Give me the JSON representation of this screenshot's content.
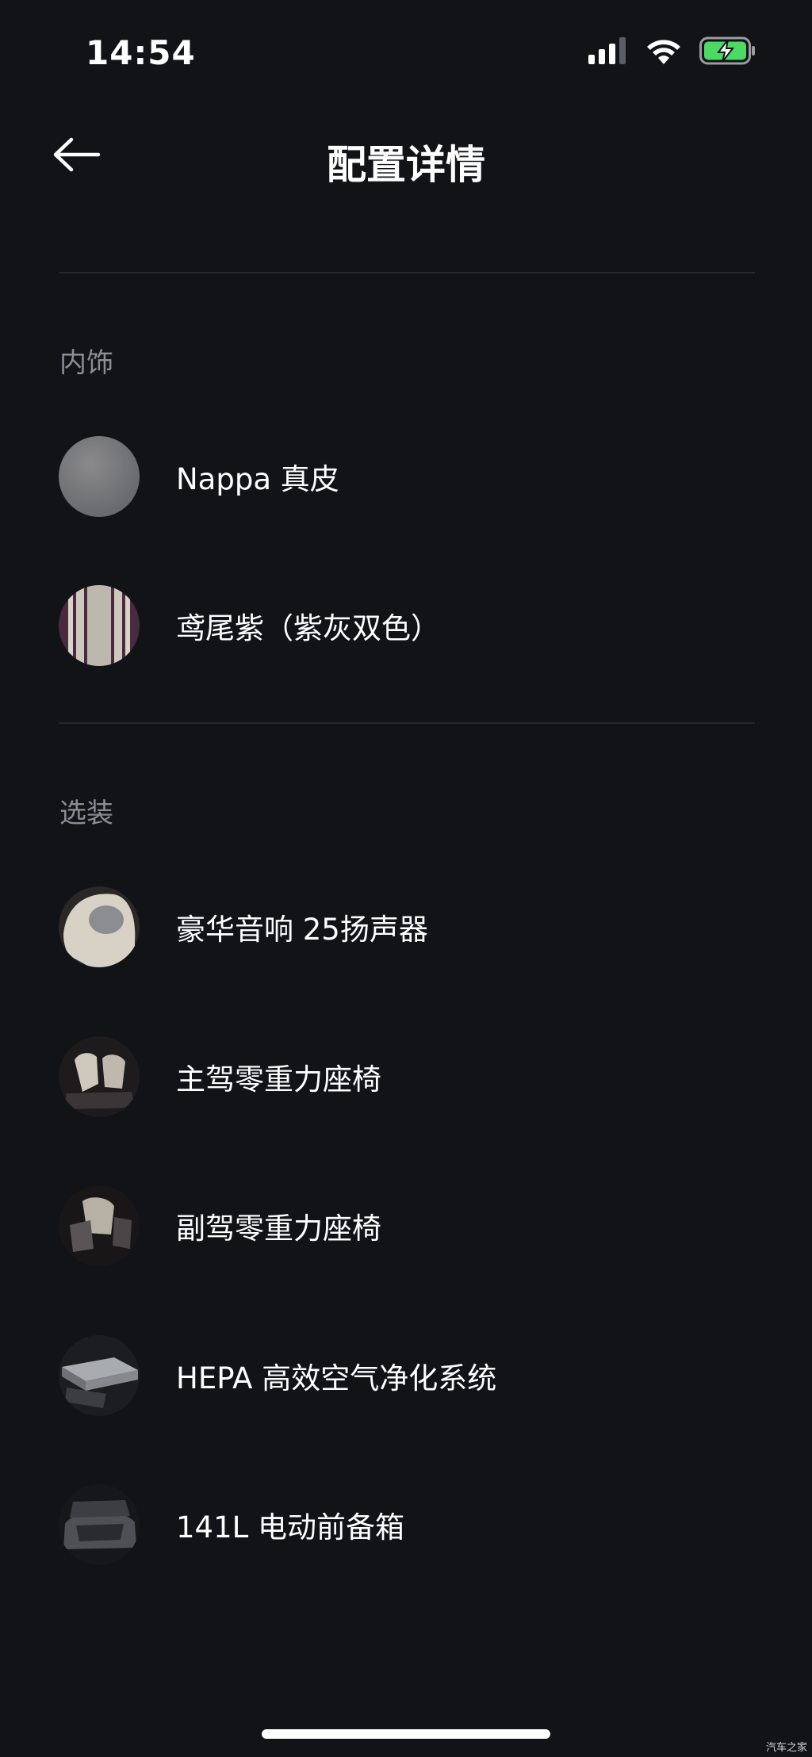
{
  "status_bar": {
    "time": "14:54",
    "icons": [
      "signal-icon",
      "wifi-icon",
      "battery-charging-icon"
    ],
    "battery_color": "#4cd964"
  },
  "header": {
    "back_icon": "arrow-left-icon",
    "title": "配置详情"
  },
  "sections": {
    "interior": {
      "title": "内饰",
      "items": [
        {
          "label": "Nappa 真皮",
          "thumb": "gray-leather-swatch"
        },
        {
          "label": "鸢尾紫（紫灰双色）",
          "thumb": "purple-gray-stripe-swatch"
        }
      ]
    },
    "options": {
      "title": "选装",
      "items": [
        {
          "label": "豪华音响 25扬声器",
          "thumb": "headrest-speaker-photo"
        },
        {
          "label": "主驾零重力座椅",
          "thumb": "driver-seat-photo"
        },
        {
          "label": "副驾零重力座椅",
          "thumb": "passenger-seat-photo"
        },
        {
          "label": "HEPA 高效空气净化系统",
          "thumb": "air-filter-photo"
        },
        {
          "label": "141L 电动前备箱",
          "thumb": "front-trunk-photo"
        }
      ]
    }
  },
  "watermark": "汽车之家",
  "colors": {
    "background": "#111317",
    "divider": "#23262c",
    "section_title": "#8b8e96",
    "text": "#ffffff"
  }
}
